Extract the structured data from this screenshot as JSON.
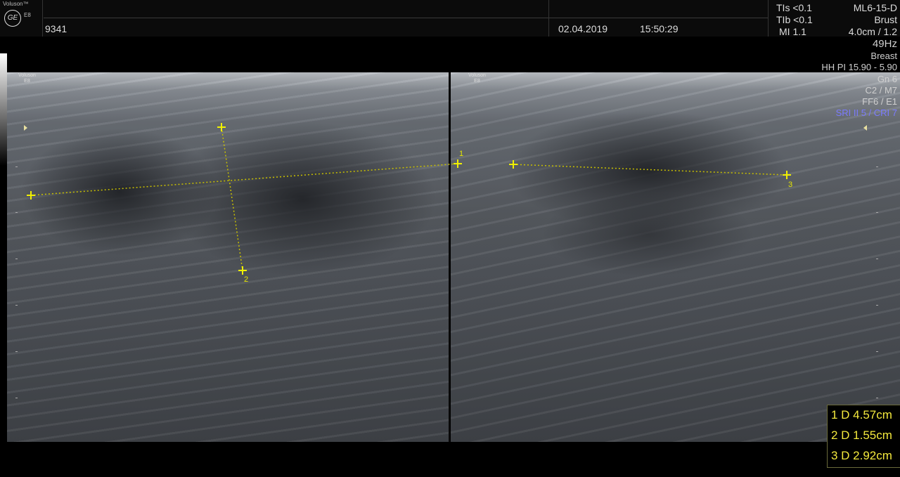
{
  "header": {
    "brand": "Voluson™",
    "model": "E8",
    "logo_text": "GE",
    "patient_id": "9341",
    "date": "02.04.2019",
    "time": "15:50:29",
    "tis": "TIs <0.1",
    "tib": "TIb <0.1",
    "mi": "MI  1.1",
    "probe": "ML6-15-D",
    "preset": "Brust",
    "depth": "4.0cm / 1.2"
  },
  "params": {
    "frame_rate": "49Hz",
    "application": "Breast",
    "harmonic": "HH PI 15.90 - 5.90",
    "gain": "Gn  6",
    "map": "C2 / M7",
    "filter": "FF6 / E1",
    "sri": "SRI II 5 / CRI 7"
  },
  "panels": {
    "left_logo": "Voluson",
    "left_model": "E8",
    "right_logo": "Voluson",
    "right_model": "E8"
  },
  "calipers": {
    "label_1": "1",
    "label_2": "2",
    "label_3": "3"
  },
  "measurements": [
    {
      "label": "1 D 4.57cm"
    },
    {
      "label": "2 D 1.55cm"
    },
    {
      "label": "3 D 2.92cm"
    }
  ],
  "colors": {
    "caliper": "#e6e600",
    "measurement_text": "#f4e93d",
    "sri_text": "#7b7bff"
  }
}
